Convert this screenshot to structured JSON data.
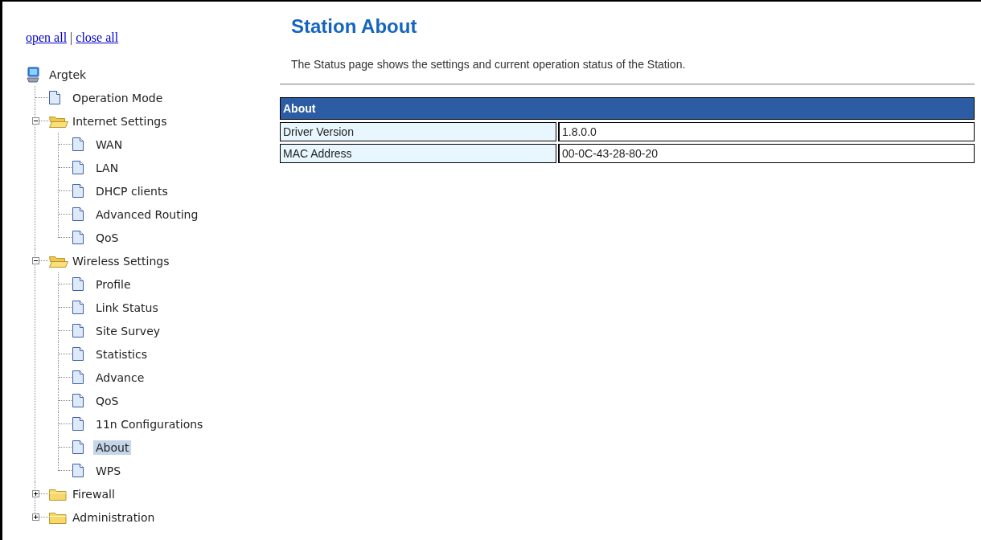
{
  "sidebar": {
    "links": [
      {
        "label": "open all"
      },
      {
        "label": "close all"
      }
    ],
    "separator": "|",
    "tree": {
      "label": "Argtek",
      "selected": false,
      "children": [
        {
          "label": "Operation Mode",
          "kind": "page",
          "selected": false
        },
        {
          "label": "Internet Settings",
          "kind": "folder",
          "expanded": true,
          "selected": false,
          "children": [
            {
              "label": "WAN",
              "kind": "page",
              "selected": false
            },
            {
              "label": "LAN",
              "kind": "page",
              "selected": false
            },
            {
              "label": "DHCP clients",
              "kind": "page",
              "selected": false
            },
            {
              "label": "Advanced Routing",
              "kind": "page",
              "selected": false
            },
            {
              "label": "QoS",
              "kind": "page",
              "selected": false
            }
          ]
        },
        {
          "label": "Wireless Settings",
          "kind": "folder",
          "expanded": true,
          "selected": false,
          "children": [
            {
              "label": "Profile",
              "kind": "page",
              "selected": false
            },
            {
              "label": "Link Status",
              "kind": "page",
              "selected": false
            },
            {
              "label": "Site Survey",
              "kind": "page",
              "selected": false
            },
            {
              "label": "Statistics",
              "kind": "page",
              "selected": false
            },
            {
              "label": "Advance",
              "kind": "page",
              "selected": false
            },
            {
              "label": "QoS",
              "kind": "page",
              "selected": false
            },
            {
              "label": "11n Configurations",
              "kind": "page",
              "selected": false
            },
            {
              "label": "About",
              "kind": "page",
              "selected": true
            },
            {
              "label": "WPS",
              "kind": "page",
              "selected": false
            }
          ]
        },
        {
          "label": "Firewall",
          "kind": "folder",
          "expanded": false,
          "selected": false
        },
        {
          "label": "Administration",
          "kind": "folder",
          "expanded": false,
          "selected": false
        }
      ]
    }
  },
  "page": {
    "title": "Station About",
    "description": "The Status page shows the settings and current operation status of the Station."
  },
  "table": {
    "heading": "About",
    "rows": [
      {
        "label": "Driver Version",
        "value": "1.8.0.0"
      },
      {
        "label": "MAC Address",
        "value": "00-0C-43-28-80-20"
      }
    ]
  }
}
